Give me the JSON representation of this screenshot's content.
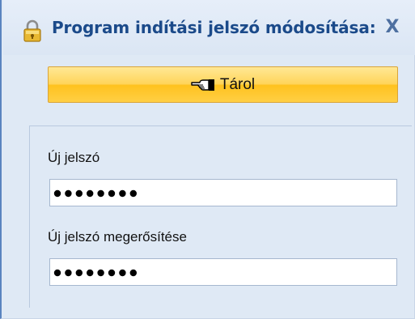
{
  "dialog": {
    "title": "Program indítási jelszó módosítása:",
    "close_label": "X",
    "title_icon": "lock-icon"
  },
  "toolbar": {
    "save_label": "Tárol",
    "save_icon": "pointing-hand-icon"
  },
  "form": {
    "new_password": {
      "label": "Új jelszó",
      "value_masked": "••••••••",
      "masked_length": 8
    },
    "confirm_password": {
      "label": "Új jelszó megerősítése",
      "value_masked": "••••••••",
      "masked_length": 8
    }
  },
  "colors": {
    "title_text": "#1b4a8a",
    "window_background": "#dfe9f5",
    "save_button_fill": "#ffc21e",
    "save_button_border": "#d9a43a",
    "field_border": "#a6b7cf"
  }
}
